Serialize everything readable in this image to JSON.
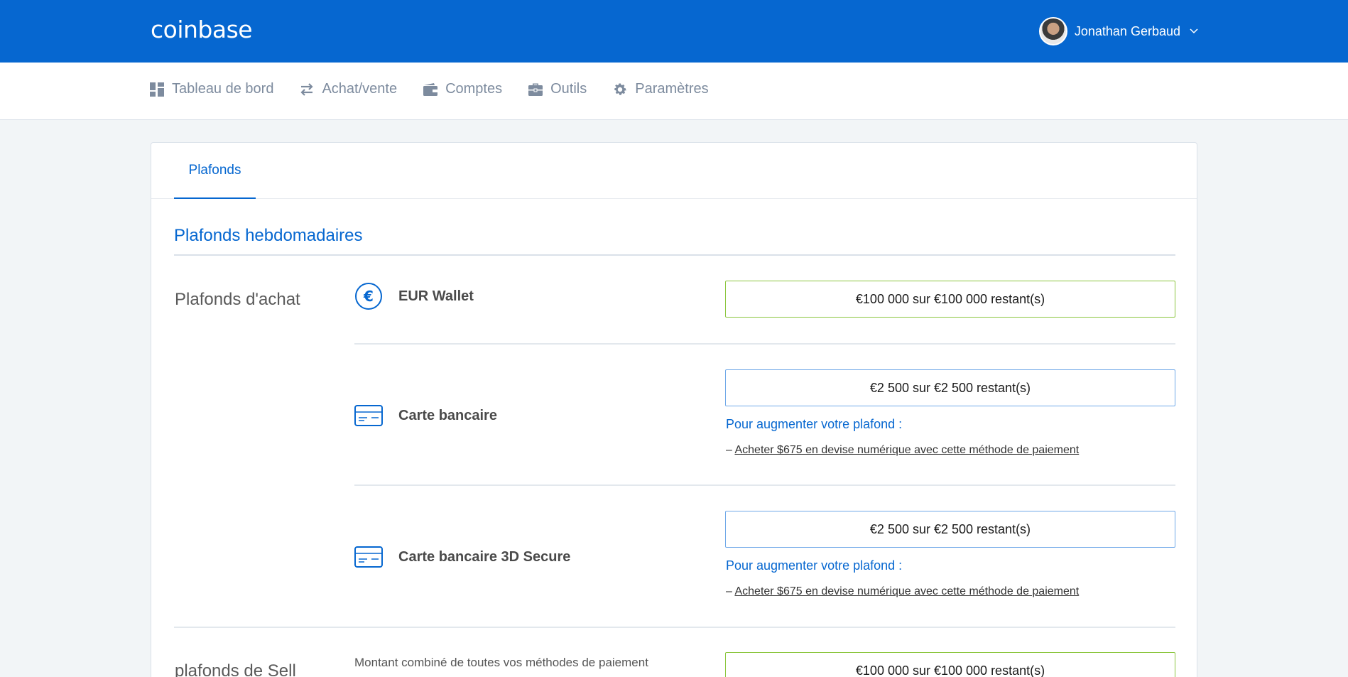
{
  "header": {
    "logo": "coinbase",
    "user_name": "Jonathan Gerbaud",
    "chevron": "⌵"
  },
  "nav": {
    "items": [
      {
        "label": "Tableau de bord",
        "icon": "dashboard-icon"
      },
      {
        "label": "Achat/vente",
        "icon": "swap-arrows-icon"
      },
      {
        "label": "Comptes",
        "icon": "wallet-icon"
      },
      {
        "label": "Outils",
        "icon": "toolbox-icon"
      },
      {
        "label": "Paramètres",
        "icon": "gear-icon"
      }
    ]
  },
  "tabs": {
    "active": "Plafonds"
  },
  "section": {
    "title": "Plafonds hebdomadaires"
  },
  "buy_limits": {
    "label": "Plafonds d'achat",
    "methods": [
      {
        "name": "EUR Wallet",
        "icon": "euro-icon",
        "limit": "€100 000 sur €100 000 restant(s)",
        "status_color": "#8cc63f"
      },
      {
        "name": "Carte bancaire",
        "icon": "credit-card-icon",
        "limit": "€2 500 sur €2 500 restant(s)",
        "increase_title": "Pour augmenter votre plafond :",
        "increase_prefix": "– ",
        "increase_link": "Acheter $675 en devise numérique avec cette méthode de paiement"
      },
      {
        "name": "Carte bancaire 3D Secure",
        "icon": "credit-card-icon",
        "limit": "€2 500 sur €2 500 restant(s)",
        "increase_title": "Pour augmenter votre plafond :",
        "increase_prefix": "– ",
        "increase_link": "Acheter $675 en devise numérique avec cette méthode de paiement"
      }
    ]
  },
  "sell_limits": {
    "label": "plafonds de Sell",
    "description": "Montant combiné de toutes vos méthodes de paiement",
    "limit": "€100 000 sur €100 000 restant(s)"
  },
  "colors": {
    "brand": "#0667d0",
    "accent_green": "#8cc63f",
    "border_blue": "#6fa8e8"
  }
}
